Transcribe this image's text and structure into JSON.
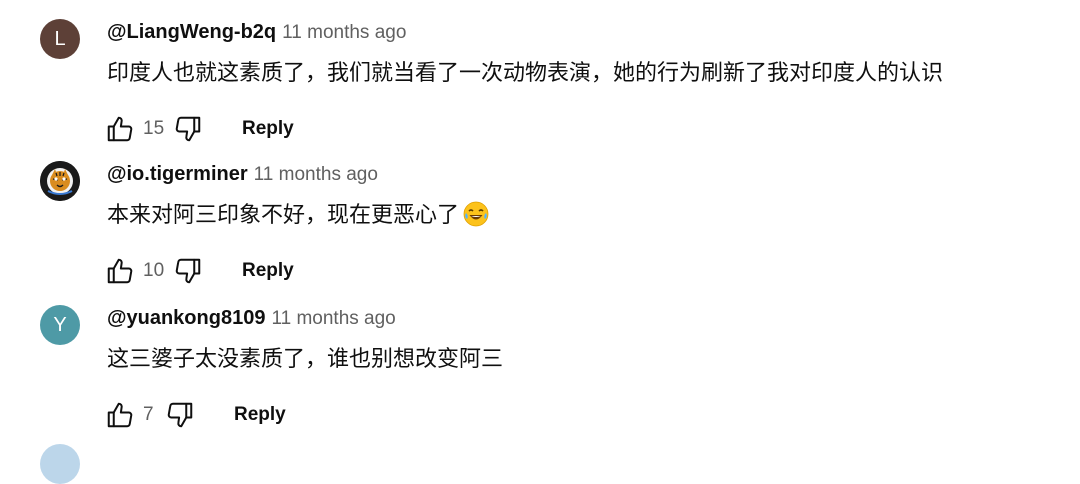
{
  "comments": [
    {
      "avatar_letter": "L",
      "avatar_color": "#5d4037",
      "handle": "@LiangWeng-b2q",
      "time": "11 months ago",
      "text": "印度人也就这素质了，我们就当看了一次动物表演，她的行为刷新了我对印度人的认识",
      "likes": "15",
      "reply_label": "Reply"
    },
    {
      "avatar_letter": "",
      "avatar_color": "#1a1a1a",
      "avatar_icon": "tiger-avatar-icon",
      "handle": "@io.tigerminer",
      "time": "11 months ago",
      "text": "本来对阿三印象不好，现在更恶心了",
      "emoji": "laughing-tears-emoji",
      "likes": "10",
      "reply_label": "Reply"
    },
    {
      "avatar_letter": "Y",
      "avatar_color": "#4e9aa6",
      "handle": "@yuankong8109",
      "time": "11 months ago",
      "text": "这三婆子太没素质了，谁也别想改变阿三",
      "likes": "7",
      "reply_label": "Reply"
    }
  ],
  "icons": {
    "like": "thumbs-up-icon",
    "dislike": "thumbs-down-icon"
  }
}
